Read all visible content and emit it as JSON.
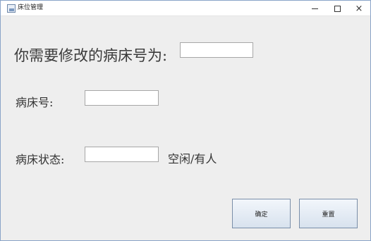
{
  "window": {
    "title": "床位管理",
    "icon": "java-app-icon",
    "controls": {
      "minimize": "minimize-icon",
      "maximize": "maximize-icon",
      "close": "×"
    }
  },
  "form": {
    "target_bed_label": "你需要修改的病床号为:",
    "target_bed_value": "",
    "bed_number_label": "病床号:",
    "bed_number_value": "",
    "bed_status_label": "病床状态:",
    "bed_status_value": "",
    "status_hint": "空闲/有人"
  },
  "buttons": {
    "confirm": "确定",
    "reset": "重置"
  }
}
